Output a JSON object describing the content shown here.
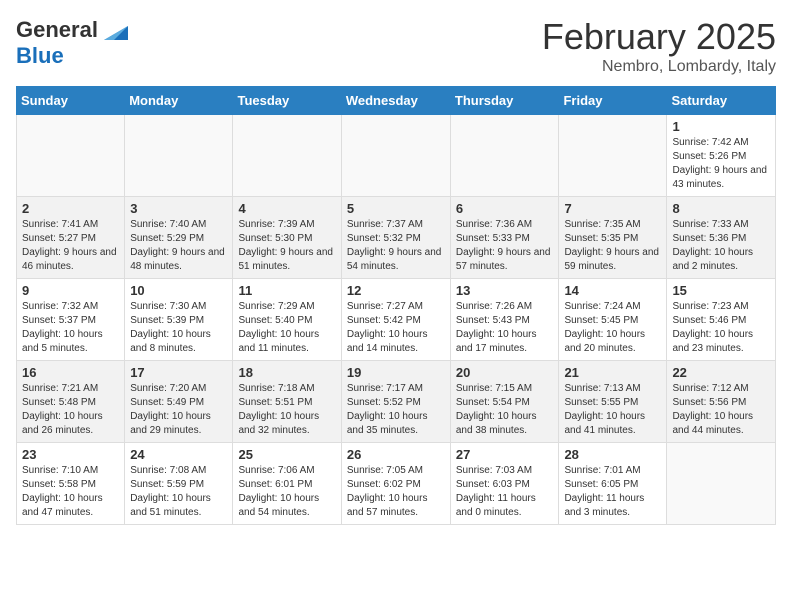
{
  "logo": {
    "general": "General",
    "blue": "Blue"
  },
  "header": {
    "month": "February 2025",
    "location": "Nembro, Lombardy, Italy"
  },
  "weekdays": [
    "Sunday",
    "Monday",
    "Tuesday",
    "Wednesday",
    "Thursday",
    "Friday",
    "Saturday"
  ],
  "weeks": [
    [
      {
        "day": "",
        "info": ""
      },
      {
        "day": "",
        "info": ""
      },
      {
        "day": "",
        "info": ""
      },
      {
        "day": "",
        "info": ""
      },
      {
        "day": "",
        "info": ""
      },
      {
        "day": "",
        "info": ""
      },
      {
        "day": "1",
        "info": "Sunrise: 7:42 AM\nSunset: 5:26 PM\nDaylight: 9 hours and 43 minutes."
      }
    ],
    [
      {
        "day": "2",
        "info": "Sunrise: 7:41 AM\nSunset: 5:27 PM\nDaylight: 9 hours and 46 minutes."
      },
      {
        "day": "3",
        "info": "Sunrise: 7:40 AM\nSunset: 5:29 PM\nDaylight: 9 hours and 48 minutes."
      },
      {
        "day": "4",
        "info": "Sunrise: 7:39 AM\nSunset: 5:30 PM\nDaylight: 9 hours and 51 minutes."
      },
      {
        "day": "5",
        "info": "Sunrise: 7:37 AM\nSunset: 5:32 PM\nDaylight: 9 hours and 54 minutes."
      },
      {
        "day": "6",
        "info": "Sunrise: 7:36 AM\nSunset: 5:33 PM\nDaylight: 9 hours and 57 minutes."
      },
      {
        "day": "7",
        "info": "Sunrise: 7:35 AM\nSunset: 5:35 PM\nDaylight: 9 hours and 59 minutes."
      },
      {
        "day": "8",
        "info": "Sunrise: 7:33 AM\nSunset: 5:36 PM\nDaylight: 10 hours and 2 minutes."
      }
    ],
    [
      {
        "day": "9",
        "info": "Sunrise: 7:32 AM\nSunset: 5:37 PM\nDaylight: 10 hours and 5 minutes."
      },
      {
        "day": "10",
        "info": "Sunrise: 7:30 AM\nSunset: 5:39 PM\nDaylight: 10 hours and 8 minutes."
      },
      {
        "day": "11",
        "info": "Sunrise: 7:29 AM\nSunset: 5:40 PM\nDaylight: 10 hours and 11 minutes."
      },
      {
        "day": "12",
        "info": "Sunrise: 7:27 AM\nSunset: 5:42 PM\nDaylight: 10 hours and 14 minutes."
      },
      {
        "day": "13",
        "info": "Sunrise: 7:26 AM\nSunset: 5:43 PM\nDaylight: 10 hours and 17 minutes."
      },
      {
        "day": "14",
        "info": "Sunrise: 7:24 AM\nSunset: 5:45 PM\nDaylight: 10 hours and 20 minutes."
      },
      {
        "day": "15",
        "info": "Sunrise: 7:23 AM\nSunset: 5:46 PM\nDaylight: 10 hours and 23 minutes."
      }
    ],
    [
      {
        "day": "16",
        "info": "Sunrise: 7:21 AM\nSunset: 5:48 PM\nDaylight: 10 hours and 26 minutes."
      },
      {
        "day": "17",
        "info": "Sunrise: 7:20 AM\nSunset: 5:49 PM\nDaylight: 10 hours and 29 minutes."
      },
      {
        "day": "18",
        "info": "Sunrise: 7:18 AM\nSunset: 5:51 PM\nDaylight: 10 hours and 32 minutes."
      },
      {
        "day": "19",
        "info": "Sunrise: 7:17 AM\nSunset: 5:52 PM\nDaylight: 10 hours and 35 minutes."
      },
      {
        "day": "20",
        "info": "Sunrise: 7:15 AM\nSunset: 5:54 PM\nDaylight: 10 hours and 38 minutes."
      },
      {
        "day": "21",
        "info": "Sunrise: 7:13 AM\nSunset: 5:55 PM\nDaylight: 10 hours and 41 minutes."
      },
      {
        "day": "22",
        "info": "Sunrise: 7:12 AM\nSunset: 5:56 PM\nDaylight: 10 hours and 44 minutes."
      }
    ],
    [
      {
        "day": "23",
        "info": "Sunrise: 7:10 AM\nSunset: 5:58 PM\nDaylight: 10 hours and 47 minutes."
      },
      {
        "day": "24",
        "info": "Sunrise: 7:08 AM\nSunset: 5:59 PM\nDaylight: 10 hours and 51 minutes."
      },
      {
        "day": "25",
        "info": "Sunrise: 7:06 AM\nSunset: 6:01 PM\nDaylight: 10 hours and 54 minutes."
      },
      {
        "day": "26",
        "info": "Sunrise: 7:05 AM\nSunset: 6:02 PM\nDaylight: 10 hours and 57 minutes."
      },
      {
        "day": "27",
        "info": "Sunrise: 7:03 AM\nSunset: 6:03 PM\nDaylight: 11 hours and 0 minutes."
      },
      {
        "day": "28",
        "info": "Sunrise: 7:01 AM\nSunset: 6:05 PM\nDaylight: 11 hours and 3 minutes."
      },
      {
        "day": "",
        "info": ""
      }
    ]
  ]
}
